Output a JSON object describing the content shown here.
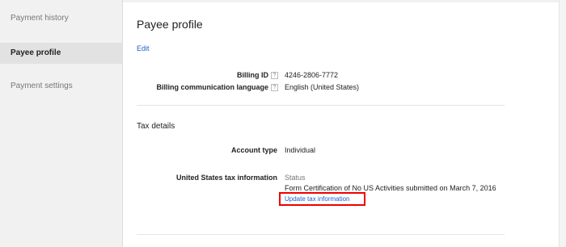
{
  "sidebar": {
    "items": [
      {
        "label": "Payment history"
      },
      {
        "label": "Payee profile"
      },
      {
        "label": "Payment settings"
      }
    ]
  },
  "main": {
    "title": "Payee profile",
    "edit_label": "Edit",
    "billing_id_label": "Billing ID",
    "billing_id_value": "4246-2806-7772",
    "billing_lang_label": "Billing communication language",
    "billing_lang_value": "English (United States)",
    "help_glyph": "?",
    "tax_section_title": "Tax details",
    "account_type_label": "Account type",
    "account_type_value": "Individual",
    "us_tax_label": "United States tax information",
    "status_label": "Status",
    "status_text": "Form Certification of No US Activities submitted on March 7, 2016",
    "update_link_label": "Update tax information"
  },
  "colors": {
    "accent_link": "#1a5fce",
    "highlight_box": "#e00000"
  }
}
